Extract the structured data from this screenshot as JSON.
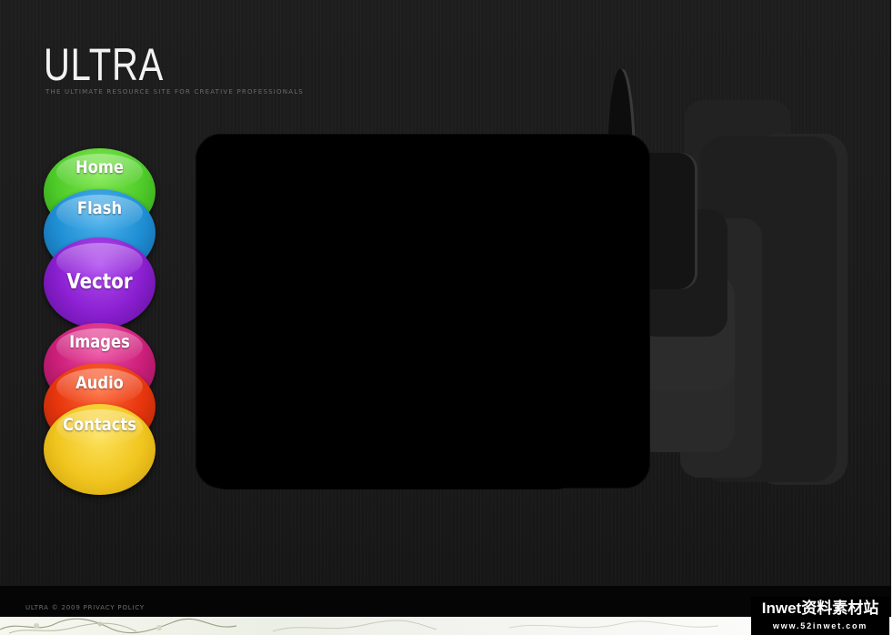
{
  "brand": {
    "title": "ULTRA",
    "tagline": "THE ULTIMATE RESOURCE SITE FOR CREATIVE PROFESSIONALS"
  },
  "nav": {
    "items": [
      {
        "label": "Home",
        "color": "#4fcc2a"
      },
      {
        "label": "Flash",
        "color": "#1f8fd4"
      },
      {
        "label": "Vector",
        "color": "#8a1fd0"
      },
      {
        "label": "Images",
        "color": "#cc1f7a"
      },
      {
        "label": "Audio",
        "color": "#e8360e"
      },
      {
        "label": "Contacts",
        "color": "#f0c51e"
      }
    ]
  },
  "footer": {
    "copyright": "ULTRA © 2009",
    "privacy_label": "PRIVACY POLICY"
  },
  "watermark": {
    "title": "Inwet资料素材站",
    "url": "www.52inwet.com"
  },
  "colors": {
    "background": "#1a1a1a",
    "content_frame": "#000000",
    "footer_bar": "#050505"
  }
}
